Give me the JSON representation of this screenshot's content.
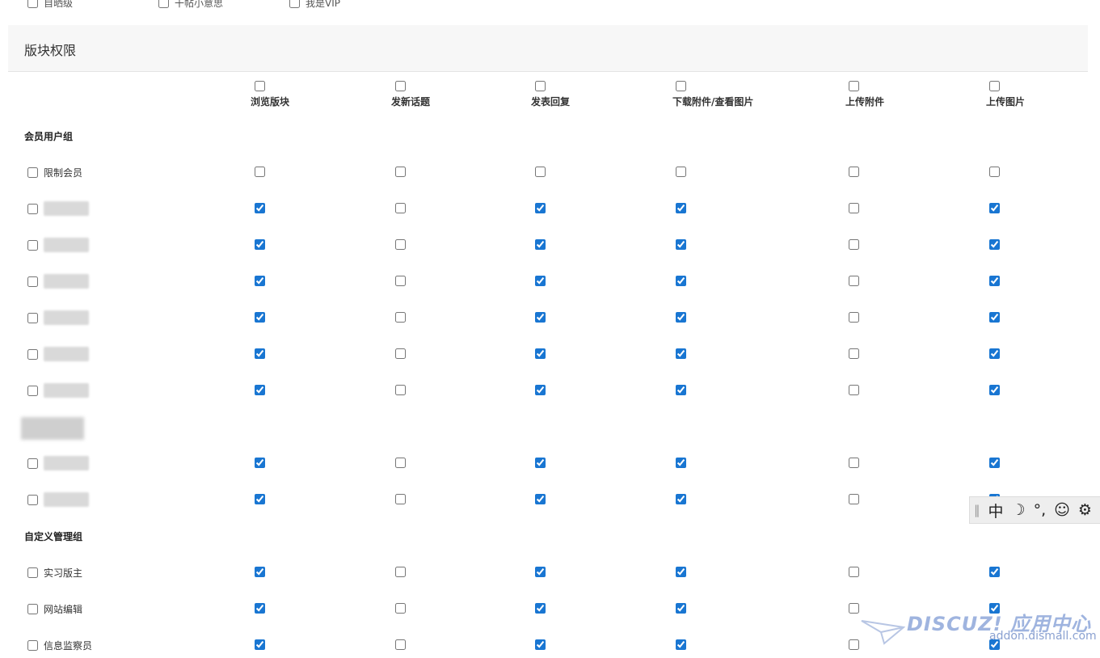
{
  "top_options": [
    {
      "label": "自晒级",
      "checked": false
    },
    {
      "label": "干帖小意思",
      "checked": false
    },
    {
      "label": "我是VIP",
      "checked": false
    }
  ],
  "section": {
    "title": "版块权限"
  },
  "columns": [
    "浏览版块",
    "发新话题",
    "发表回复",
    "下载附件/查看图片",
    "上传附件",
    "上传图片"
  ],
  "groups": [
    {
      "title": "会员用户组",
      "rows": [
        {
          "label": "限制会员",
          "blurred": false,
          "values": [
            false,
            false,
            false,
            false,
            false,
            false
          ]
        },
        {
          "label": "",
          "blurred": true,
          "values": [
            true,
            false,
            true,
            true,
            false,
            true
          ]
        },
        {
          "label": "",
          "blurred": true,
          "values": [
            true,
            false,
            true,
            true,
            false,
            true
          ]
        },
        {
          "label": "",
          "blurred": true,
          "values": [
            true,
            false,
            true,
            true,
            false,
            true
          ]
        },
        {
          "label": "",
          "blurred": true,
          "values": [
            true,
            false,
            true,
            true,
            false,
            true
          ]
        },
        {
          "label": "",
          "blurred": true,
          "values": [
            true,
            false,
            true,
            true,
            false,
            true
          ]
        },
        {
          "label": "员",
          "blurred": true,
          "values": [
            true,
            false,
            true,
            true,
            false,
            true
          ]
        }
      ]
    },
    {
      "title": "",
      "blurred": true,
      "rows": [
        {
          "label": "",
          "blurred": true,
          "values": [
            true,
            false,
            true,
            true,
            false,
            true
          ]
        },
        {
          "label": "",
          "blurred": true,
          "values": [
            true,
            false,
            true,
            true,
            false,
            true
          ]
        }
      ]
    },
    {
      "title": "自定义管理组",
      "rows": [
        {
          "label": "实习版主",
          "blurred": false,
          "values": [
            true,
            false,
            true,
            true,
            false,
            true
          ]
        },
        {
          "label": "网站编辑",
          "blurred": false,
          "values": [
            true,
            false,
            true,
            true,
            false,
            true
          ]
        },
        {
          "label": "信息监察员",
          "blurred": false,
          "values": [
            true,
            false,
            true,
            true,
            false,
            true
          ]
        }
      ]
    }
  ],
  "ime_toolbar": {
    "mode": "中",
    "icons": [
      "moon-icon",
      "punctuation-icon",
      "emoji-icon",
      "gear-icon"
    ],
    "punct": "°,",
    "emoji": "☺",
    "gear": "⚙",
    "moon": "☽"
  },
  "watermark": {
    "brand": "DISCUZ! 应用中心",
    "url": "addon.dismall.com"
  },
  "colors": {
    "checkbox_accent": "#1976d2",
    "header_bg": "#f7f7f7",
    "watermark": "#9fb4df"
  }
}
